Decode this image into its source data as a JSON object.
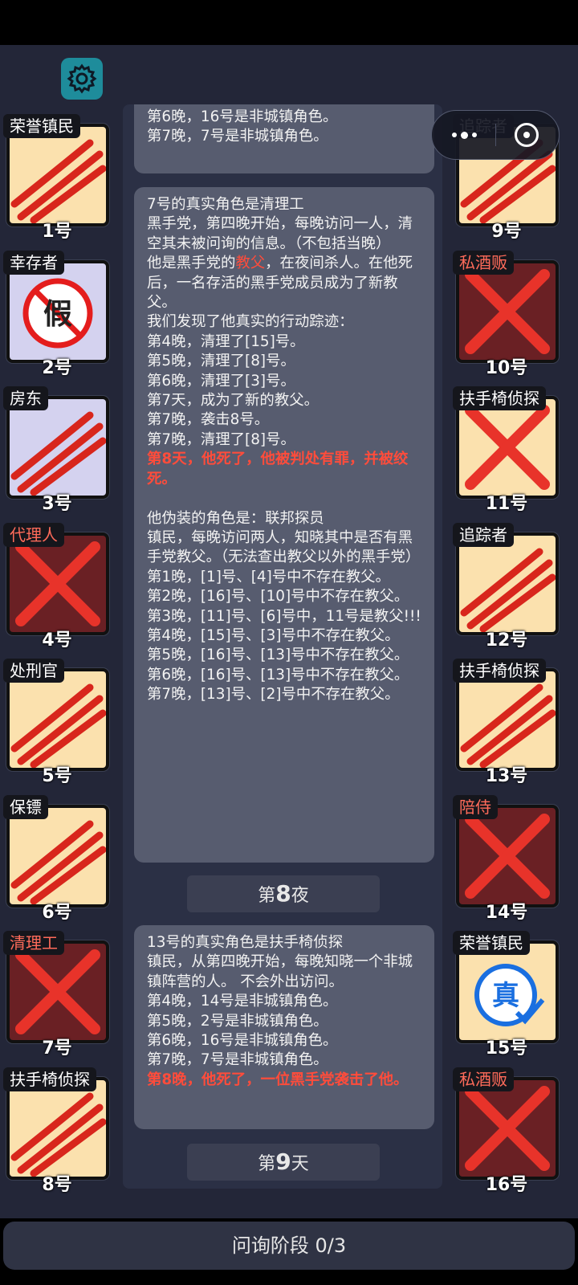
{
  "header": {
    "settings_icon": "gear-icon",
    "menu_icon": "more-dots-icon",
    "close_icon": "target-close-icon"
  },
  "players_left": [
    {
      "number": "1号",
      "role": "荣誉镇民",
      "bg": "beige",
      "overlay": "claw"
    },
    {
      "number": "2号",
      "role": "幸存者",
      "bg": "lav",
      "overlay": "fake-stamp"
    },
    {
      "number": "3号",
      "role": "房东",
      "bg": "lav",
      "overlay": "claw"
    },
    {
      "number": "4号",
      "role": "代理人",
      "bg": "dark",
      "overlay": "cross"
    },
    {
      "number": "5号",
      "role": "处刑官",
      "bg": "beige",
      "overlay": "claw"
    },
    {
      "number": "6号",
      "role": "保镖",
      "bg": "beige",
      "overlay": "claw"
    },
    {
      "number": "7号",
      "role": "清理工",
      "bg": "dark",
      "overlay": "cross",
      "role_color": "#ff6b5a"
    },
    {
      "number": "8号",
      "role": "扶手椅侦探",
      "bg": "beige",
      "overlay": "claw"
    }
  ],
  "players_right": [
    {
      "number": "9号",
      "role": "追踪者",
      "bg": "beige",
      "overlay": "claw"
    },
    {
      "number": "10号",
      "role": "私酒贩",
      "bg": "dark",
      "overlay": "cross"
    },
    {
      "number": "11号",
      "role": "扶手椅侦探",
      "bg": "beige",
      "overlay": "cross"
    },
    {
      "number": "12号",
      "role": "追踪者",
      "bg": "beige",
      "overlay": "claw"
    },
    {
      "number": "13号",
      "role": "扶手椅侦探",
      "bg": "beige",
      "overlay": "claw"
    },
    {
      "number": "14号",
      "role": "陪侍",
      "bg": "dark",
      "overlay": "cross"
    },
    {
      "number": "15号",
      "role": "荣誉镇民",
      "bg": "beige",
      "overlay": "true-stamp"
    },
    {
      "number": "16号",
      "role": "私酒贩",
      "bg": "dark",
      "overlay": "cross"
    }
  ],
  "log": {
    "top_bubble": [
      "第6晚，16号是非城镇角色。",
      "第7晚，7号是非城镇角色。"
    ],
    "cleaner": {
      "l1": "7号的真实角色是清理工",
      "l2": "黑手党，第四晚开始，每晚访问一人，清空其未被问询的信息。（不包括当晚）",
      "l3a": "他是黑手党的",
      "l3b": "教父",
      "l3c": "，在夜间杀人。在他死后，一名存活的黑手党成员成为了新教父。",
      "l4": "我们发现了他真实的行动踪迹：",
      "trail": [
        "第4晚，清理了[15]号。",
        "第5晚，清理了[8]号。",
        "第6晚，清理了[3]号。",
        "第7天，成为了新的教父。",
        "第7晚，袭击8号。",
        "第7晚，清理了[8]号。"
      ],
      "death": "第8天，他死了，他被判处有罪，并被绞死。",
      "disguise": "他伪装的角色是：联邦探员",
      "disguise_desc": "镇民，每晚访问两人，知晓其中是否有黑手党教父。（无法查出教父以外的黑手党）",
      "disguise_trail": [
        "第1晚，[1]号、[4]号中不存在教父。",
        "第2晚，[16]号、[10]号中不存在教父。",
        "第3晚，[11]号、[6]号中，11号是教父!!!",
        "第4晚，[15]号、[3]号中不存在教父。",
        "第5晚，[16]号、[13]号中不存在教父。",
        "第6晚，[16]号、[13]号中不存在教父。",
        "第7晚，[13]号、[2]号中不存在教父。"
      ]
    },
    "phase1_prefix": "第",
    "phase1_num": "8",
    "phase1_suffix": "夜",
    "armchair": {
      "l1": "13号的真实角色是扶手椅侦探",
      "l2": "镇民，从第四晚开始，每晚知晓一个非城镇阵营的人。 不会外出访问。",
      "trail": [
        "第4晚，14号是非城镇角色。",
        "第5晚，2号是非城镇角色。",
        "第6晚，16号是非城镇角色。",
        "第7晚，7号是非城镇角色。"
      ],
      "death": "第8晚，他死了，一位黑手党袭击了他。"
    },
    "phase2_prefix": "第",
    "phase2_num": "9",
    "phase2_suffix": "天"
  },
  "footer": {
    "label": "问询阶段 0/3"
  },
  "colors": {
    "accent_red": "#ff4c3b",
    "gear_bg": "#1e8c9b",
    "card_beige": "#fbe1ae",
    "card_lavender": "#d4d2ef",
    "card_dark": "#6a2024"
  }
}
